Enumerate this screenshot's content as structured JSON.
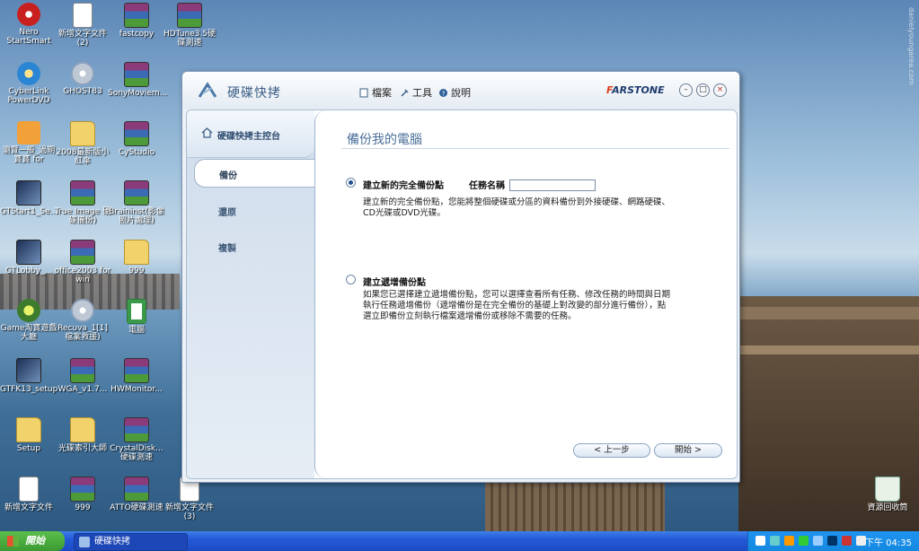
{
  "desktop": {
    "watermark": "danielyoungarea.com",
    "icons": [
      {
        "label": "Nero StartSmart",
        "kind": "nero"
      },
      {
        "label": "新增文字文件 (2)",
        "kind": "doc"
      },
      {
        "label": "fastcopy",
        "kind": "winrar"
      },
      {
        "label": "HDTune3.5硬碟測速",
        "kind": "winrar"
      },
      {
        "label": "CyberLink PowerDVD",
        "kind": "cyber"
      },
      {
        "label": "GHOST83",
        "kind": "cd"
      },
      {
        "label": "SonyMoviem...",
        "kind": "winrar"
      },
      {
        "label": "瀏覽一般_過期寶寶 for",
        "kind": "truck"
      },
      {
        "label": "2008最新版小紅傘",
        "kind": "folder"
      },
      {
        "label": "CyStudio",
        "kind": "winrar"
      },
      {
        "label": "GTStart1_Se...",
        "kind": "gt"
      },
      {
        "label": "True Image 硬碟備份)",
        "kind": "winrar"
      },
      {
        "label": "Braininst(影像照片處理)",
        "kind": "winrar"
      },
      {
        "label": "GTLobby_...",
        "kind": "gt"
      },
      {
        "label": "office2003 for win",
        "kind": "winrar"
      },
      {
        "label": "999",
        "kind": "folder"
      },
      {
        "label": "Game淘寶遊戲大廳",
        "kind": "game"
      },
      {
        "label": "Recuva_1[1] 檔案救援)",
        "kind": "cd"
      },
      {
        "label": "電腦",
        "kind": "xls"
      },
      {
        "label": "GTFK13_setup",
        "kind": "gt"
      },
      {
        "label": "WGA_v1.7...",
        "kind": "winrar"
      },
      {
        "label": "HWMonitor...",
        "kind": "winrar"
      },
      {
        "label": "Setup",
        "kind": "folder"
      },
      {
        "label": "光碟索引大師",
        "kind": "folder"
      },
      {
        "label": "CrystalDisk... 硬碟測速",
        "kind": "winrar"
      },
      {
        "label": "新增文字文件",
        "kind": "doc"
      },
      {
        "label": "999",
        "kind": "winrar"
      },
      {
        "label": "ATTO硬碟測速",
        "kind": "winrar"
      },
      {
        "label": "新增文字文件 (3)",
        "kind": "doc"
      },
      {
        "label": "資源回收筒",
        "kind": "recycle"
      }
    ]
  },
  "window": {
    "app_title": "硬碟快拷",
    "menu": {
      "file": "檔案",
      "tools": "工具",
      "help": "說明"
    },
    "brand": {
      "prefix": "F",
      "rest": "ARSTONE"
    },
    "controls": {
      "minimize": "–",
      "restore": "□",
      "close": "×"
    },
    "nav": {
      "home": "硬碟快拷主控台",
      "items": [
        "備份",
        "還原",
        "複製"
      ],
      "active": "備份"
    },
    "content": {
      "title": "備份我的電腦",
      "option_full": {
        "label": "建立新的完全備份點",
        "selected": true,
        "task_name_label": "任務名稱",
        "task_name_value": "",
        "description_line1": "建立新的完全備份點，您能將整個硬碟或分區的資料備份到外接硬碟、網路硬碟、",
        "description_line2": "CD光碟或DVD光碟。"
      },
      "option_incremental": {
        "label": "建立遞增備份點",
        "selected": false,
        "description_line1": "如果您已選擇建立遞增備份點，您可以選擇查看所有任務、修改任務的時間與日期",
        "description_line2": "執行任務遞增備份（遞增備份是在完全備份的基礎上對改變的部分進行備份），點",
        "description_line3": "選立即備份立刻執行檔案遞增備份或移除不需要的任務。"
      },
      "buttons": {
        "prev": "< 上一步",
        "next": "開始 >"
      }
    }
  },
  "taskbar": {
    "start": "開始",
    "task": "硬碟快拷",
    "clock": "下午 04:35"
  }
}
